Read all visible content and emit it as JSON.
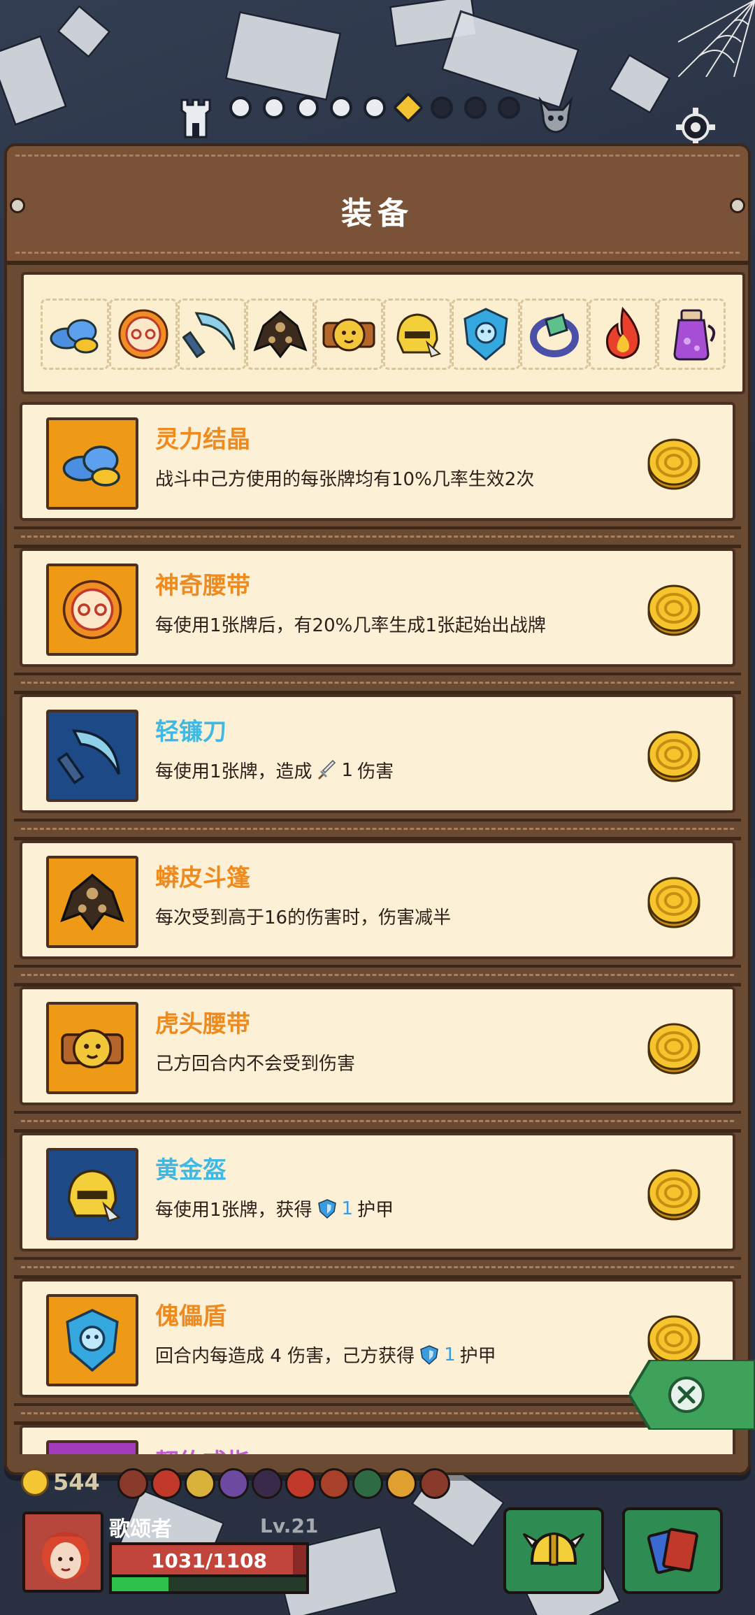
{
  "panel": {
    "title": "装备"
  },
  "progress": {
    "nodes": [
      "done",
      "done",
      "done",
      "done",
      "done",
      "current",
      "dark",
      "dark",
      "dark"
    ]
  },
  "strip": {
    "slots": [
      "crystal-icon",
      "belt-icon",
      "sickle-icon",
      "cloak-icon",
      "tiger-belt-icon",
      "helmet-icon",
      "shield-icon",
      "ring-icon",
      "fire-icon",
      "potion-icon"
    ]
  },
  "items": [
    {
      "name": "灵力结晶",
      "desc": "战斗中己方使用的每张牌均有10%几率生效2次",
      "color": "orange",
      "icon": "crystal-icon"
    },
    {
      "name": "神奇腰带",
      "desc": "每使用1张牌后，有20%几率生成1张起始出战牌",
      "color": "orange",
      "icon": "belt-icon"
    },
    {
      "name": "轻镰刀",
      "desc_pre": "每使用1张牌，造成",
      "desc_num": "1",
      "desc_post": "伤害",
      "color": "blue",
      "icon": "sickle-icon",
      "inline_icon": "sword-icon"
    },
    {
      "name": "蟒皮斗篷",
      "desc": "每次受到高于16的伤害时，伤害减半",
      "color": "orange",
      "icon": "cloak-icon"
    },
    {
      "name": "虎头腰带",
      "desc": "己方回合内不会受到伤害",
      "color": "orange",
      "icon": "tiger-belt-icon"
    },
    {
      "name": "黄金盔",
      "desc_pre": "每使用1张牌，获得",
      "desc_num": "1",
      "desc_post": "护甲",
      "color": "blue",
      "icon": "helmet-icon",
      "inline_icon": "armor-icon"
    },
    {
      "name": "傀儡盾",
      "desc_pre": "回合内每造成 4 伤害，己方获得",
      "desc_num": "1",
      "desc_post": "护甲",
      "color": "orange",
      "icon": "shield-icon",
      "inline_icon": "armor-icon"
    },
    {
      "name": "契约戒指",
      "desc": "",
      "color": "purple",
      "icon": "ring-icon"
    }
  ],
  "hud": {
    "coins": "544",
    "player_name": "歌颂者",
    "level": "Lv.21",
    "hp_text": "1031/1108",
    "hp_fraction": 0.93,
    "xp_fraction": 0.29
  },
  "colors": {
    "orange_name": "#ef8a1e",
    "blue_name": "#3fb8e3",
    "card_bg": "#fcf1d6",
    "wood": "#6b4a33",
    "button_green": "#2e8c52"
  }
}
